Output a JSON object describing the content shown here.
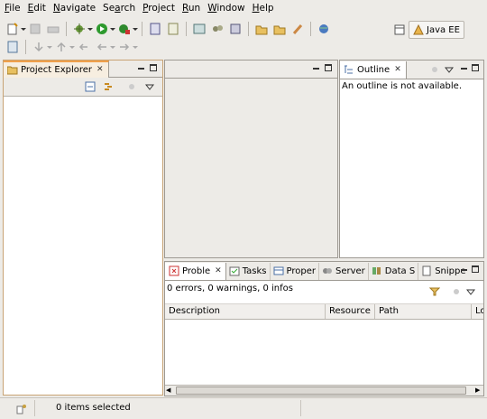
{
  "menu": [
    {
      "label": "File",
      "accel": "F",
      "rest": "ile"
    },
    {
      "label": "Edit",
      "accel": "E",
      "rest": "dit"
    },
    {
      "label": "Navigate",
      "accel": "N",
      "rest": "avigate"
    },
    {
      "label": "Search",
      "accel": "a",
      "pre": "Se",
      "rest": "rch"
    },
    {
      "label": "Project",
      "accel": "P",
      "rest": "roject"
    },
    {
      "label": "Run",
      "accel": "R",
      "rest": "un"
    },
    {
      "label": "Window",
      "accel": "W",
      "rest": "indow"
    },
    {
      "label": "Help",
      "accel": "H",
      "rest": "elp"
    }
  ],
  "perspective": {
    "label": "Java EE"
  },
  "project_explorer": {
    "title": "Project Explorer"
  },
  "outline": {
    "title": "Outline",
    "message": "An outline is not available."
  },
  "bottom": {
    "tabs": [
      "Proble",
      "Tasks",
      "Proper",
      "Server",
      "Data S",
      "Snippe"
    ],
    "summary": "0 errors, 0 warnings, 0 infos",
    "columns": [
      "Description",
      "Resource",
      "Path",
      "Lo"
    ]
  },
  "status": {
    "text": "0 items selected"
  },
  "colors": {
    "accent_tab": "#f0a04b",
    "background": "#edebe7",
    "panel_border": "#9e9a93"
  }
}
